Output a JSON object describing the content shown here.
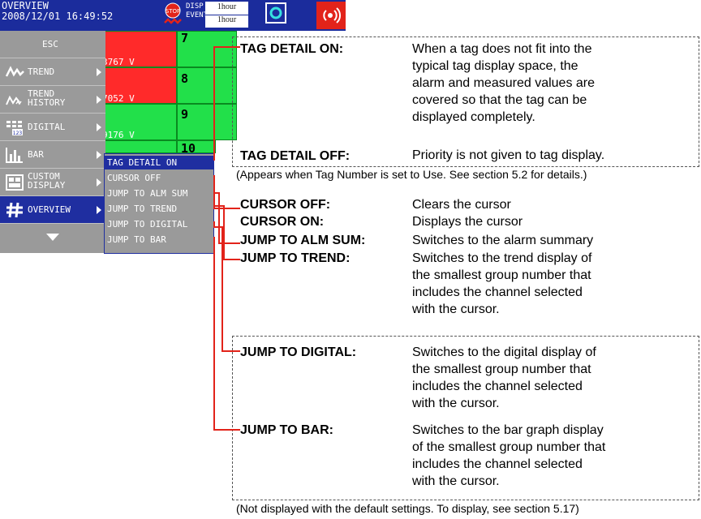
{
  "header": {
    "title_line1": "OVERVIEW",
    "title_line2": "2008/12/01 16:49:52",
    "disp_label": "DISP",
    "event_label": "EVENT",
    "disp_value": "1hour",
    "event_value": "1hour",
    "stop_icon": "stop-icon",
    "alarm_icon": "alarm-icon"
  },
  "overview": {
    "cells": [
      {
        "number": "7",
        "value": "",
        "status": "normal"
      },
      {
        "number": "8",
        "value": "",
        "status": "normal"
      },
      {
        "number": "9",
        "value": "",
        "status": "normal"
      },
      {
        "number": "10",
        "value": "",
        "status": "normal"
      }
    ],
    "left_values": [
      "3767 V",
      "7052 V",
      "9176 V"
    ]
  },
  "menu": {
    "items": [
      {
        "label": "ESC",
        "icon": ""
      },
      {
        "label": "TREND",
        "icon": "trend-icon"
      },
      {
        "label": "TREND\nHISTORY",
        "icon": "trend-history-icon"
      },
      {
        "label": "DIGITAL",
        "icon": "digital-icon"
      },
      {
        "label": "BAR",
        "icon": "bar-icon"
      },
      {
        "label": "CUSTOM\nDISPLAY",
        "icon": "custom-display-icon"
      },
      {
        "label": "OVERVIEW",
        "icon": "hash-icon"
      }
    ],
    "more_icon": "chevron-down-icon"
  },
  "submenu": {
    "items": [
      "TAG DETAIL ON",
      "CURSOR OFF",
      "JUMP TO ALM SUM",
      "JUMP TO TREND",
      "JUMP TO DIGITAL",
      "JUMP TO BAR"
    ]
  },
  "annotations": {
    "tag_detail_on_term": "TAG DETAIL ON:",
    "tag_detail_on_desc": "When a tag does not fit into the\ntypical tag display space, the\nalarm and measured values are\ncovered so that the tag can be\ndisplayed completely.",
    "tag_detail_off_term": "TAG DETAIL OFF:",
    "tag_detail_off_desc": "Priority is not given to tag display.",
    "tag_note": "(Appears when Tag Number is set to Use. See section 5.2 for details.)",
    "cursor_off_term": "CURSOR OFF:",
    "cursor_off_desc": "Clears the cursor",
    "cursor_on_term": "CURSOR ON:",
    "cursor_on_desc": "Displays the cursor",
    "alm_sum_term": "JUMP TO ALM SUM:",
    "alm_sum_desc": "Switches to the alarm summary",
    "trend_term": "JUMP TO TREND:",
    "trend_desc": "Switches to the trend display of\nthe smallest group number that\nincludes the channel selected\nwith the cursor.",
    "digital_term": "JUMP TO DIGITAL:",
    "digital_desc": "Switches to the digital display of\nthe smallest group number that\nincludes the channel selected\nwith the cursor.",
    "bar_term": "JUMP TO BAR:",
    "bar_desc": "Switches to the bar graph display\nof the smallest group number that\nincludes the channel selected\nwith the cursor.",
    "bottom_note": "(Not displayed with the default settings. To display, see section 5.17)"
  },
  "colors": {
    "header_blue": "#1b2c9c",
    "menu_gray": "#9a9a9a",
    "selected_blue": "#1f2ea0",
    "cell_green": "#22e04a",
    "cell_red": "#ff2a2a",
    "leader_red": "#e2231a"
  }
}
